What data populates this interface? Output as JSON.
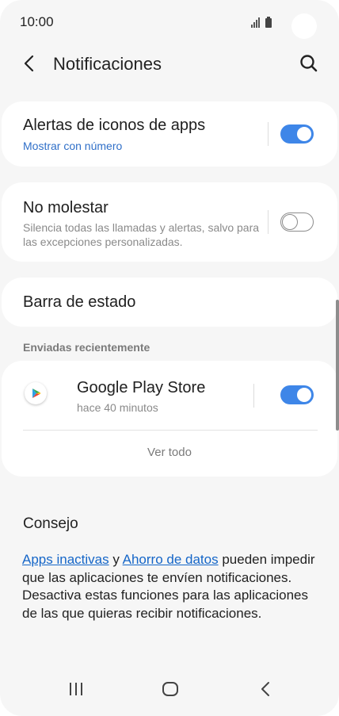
{
  "status": {
    "time": "10:00"
  },
  "header": {
    "title": "Notificaciones"
  },
  "settings": {
    "badges": {
      "title": "Alertas de iconos de apps",
      "subtitle": "Mostrar con número",
      "enabled": true
    },
    "dnd": {
      "title": "No molestar",
      "description": "Silencia todas las llamadas y alertas, salvo para las excepciones personalizadas.",
      "enabled": false
    },
    "statusbar": {
      "title": "Barra de estado"
    }
  },
  "recent": {
    "heading": "Enviadas recientemente",
    "app": {
      "name": "Google Play Store",
      "time": "hace 40 minutos",
      "enabled": true
    },
    "see_all": "Ver todo"
  },
  "tip": {
    "heading": "Consejo",
    "link1": "Apps inactivas",
    "connector": " y ",
    "link2": "Ahorro de datos",
    "text": " pueden impedir que las aplicaciones te envíen notificaciones. Desactiva estas funciones para las aplicaciones de las que quieras recibir notificaciones."
  },
  "colors": {
    "accent": "#3e86e8",
    "link": "#1566c8",
    "background": "#f6f6f6"
  },
  "icons": {
    "back": "back-arrow-icon",
    "search": "search-icon",
    "app": "google-play-icon",
    "nav_recent": "recents-icon",
    "nav_home": "home-icon",
    "nav_back": "nav-back-icon"
  }
}
